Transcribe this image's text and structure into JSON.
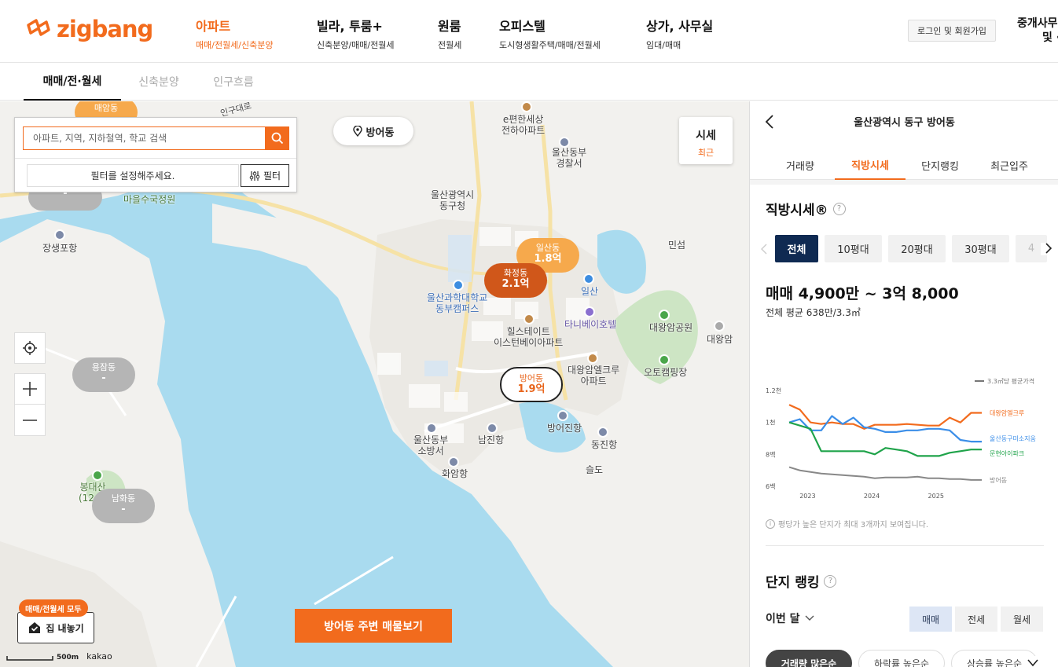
{
  "header": {
    "logo_text": "zigbang",
    "nav": [
      {
        "title": "아파트",
        "sub": "매매/전월세/신축분양"
      },
      {
        "title": "빌라, 투룸+",
        "sub": "신축분양/매매/전월세"
      },
      {
        "title": "원룸",
        "sub": "전월세"
      },
      {
        "title": "오피스텔",
        "sub": "도시형생활주택/매매/전월세"
      },
      {
        "title": "상가, 사무실",
        "sub": "임대/매매"
      }
    ],
    "login_label": "로그인 및 회원가입",
    "broker_line1": "중개사무",
    "broker_line2": "및 ·"
  },
  "subtabs": [
    "매매/전·월세",
    "신축분양",
    "인구흐름"
  ],
  "map": {
    "search_placeholder": "아파트, 지역, 지하철역, 학교 검색",
    "filter_hint": "필터를 설정해주세요.",
    "filter_label": "필터",
    "location": "방어동",
    "price_btn_title": "시세",
    "price_btn_sub": "최근",
    "nearby_label": "방어동 주변 매물보기",
    "sell_badge": "매매/전월세 모두",
    "sell_label": "집 내놓기",
    "scale_label": "500m",
    "provider": "kakao",
    "clusters": [
      {
        "name": "매암동",
        "value": ""
      },
      {
        "name": "",
        "value": "-"
      },
      {
        "name": "일산동",
        "value": "1.8억"
      },
      {
        "name": "화정동",
        "value": "2.1억"
      },
      {
        "name": "용잠동",
        "value": "-"
      },
      {
        "name": "방어동",
        "value": "1.9억"
      },
      {
        "name": "남화동",
        "value": "-"
      }
    ],
    "labels": {
      "ulsan_gucheong": "울산광역시\n동구청",
      "epyeonhan": "e편한세상\n전하아파트",
      "police": "울산동부\n경찰서",
      "maeul": "마을수국정원",
      "jangsaengpo": "장생포항",
      "minseom": "민섬",
      "ilsan": "일산",
      "tanibei": "타니베이호텔",
      "daewangam_park": "대왕암공원",
      "daewangam": "대왕암",
      "college": "울산과학대학교\n동부캠퍼스",
      "hillstate": "힐스테이트\n이스턴베이아파트",
      "elcrew": "대왕암엘크루\n아파트",
      "autocamp": "오토캠핑장",
      "fire": "울산동부\n소방서",
      "namjin": "남진항",
      "bangeojin": "방어진항",
      "dongjin": "동진항",
      "hwaam": "화암항",
      "seuldo": "슬도",
      "bongdaesan": "봉대산\n(12...)",
      "road1": "인구대로"
    }
  },
  "panel": {
    "title": "울산광역시 동구 방어동",
    "tabs": [
      "거래량",
      "직방시세",
      "단지랭킹",
      "최근입주"
    ],
    "section_title": "직방시세®",
    "sizes": [
      "전체",
      "10평대",
      "20평대",
      "30평대",
      "4"
    ],
    "price_range": "매매 4,900만 ~ 3억 8,000",
    "avg_price": "전체 평균 638만/3.3㎡",
    "chart_note": "평당가 높은 단지가 최대 3개까지 보여집니다.",
    "ranking_title": "단지 랭킹",
    "month_select": "이번 달",
    "deal_types": [
      "매매",
      "전세",
      "월세"
    ],
    "sort_options": [
      "거래량 많은순",
      "하락률 높은순",
      "상승률 높은순"
    ]
  },
  "chart_data": {
    "type": "line",
    "legend_title": "3.3㎡당 평균가격",
    "y_ticks": [
      "1.2천",
      "1천",
      "8백",
      "6백"
    ],
    "x_ticks": [
      "2023",
      "2024",
      "2025"
    ],
    "ylim": [
      600,
      1200
    ],
    "x": [
      "2022-09",
      "2022-11",
      "2023-01",
      "2023-03",
      "2023-05",
      "2023-07",
      "2023-09",
      "2023-11",
      "2024-01",
      "2024-03",
      "2024-05",
      "2024-07",
      "2024-09",
      "2024-11",
      "2025-01",
      "2025-03",
      "2025-05",
      "2025-07",
      "2025-09"
    ],
    "series": [
      {
        "name": "대왕암엘크루",
        "color": "#f26b1d",
        "values": [
          1110,
          1080,
          1000,
          990,
          1000,
          990,
          990,
          960,
          985,
          985,
          985,
          990,
          985,
          980,
          980,
          1030,
          1000,
          1060,
          1060
        ]
      },
      {
        "name": "울산동구미소지움",
        "color": "#3b8ee8",
        "values": [
          1000,
          1020,
          950,
          950,
          1040,
          990,
          1030,
          970,
          960,
          940,
          940,
          950,
          950,
          960,
          960,
          950,
          890,
          880,
          880
        ]
      },
      {
        "name": "문현아이파크",
        "color": "#1fa34a",
        "values": [
          1000,
          980,
          960,
          820,
          820,
          820,
          820,
          820,
          800,
          840,
          830,
          820,
          790,
          790,
          790,
          810,
          820,
          830,
          830
        ]
      },
      {
        "name": "방어동",
        "color": "#888888",
        "values": [
          720,
          700,
          690,
          680,
          675,
          670,
          665,
          660,
          650,
          655,
          655,
          655,
          660,
          650,
          650,
          645,
          645,
          640,
          640
        ]
      }
    ]
  }
}
